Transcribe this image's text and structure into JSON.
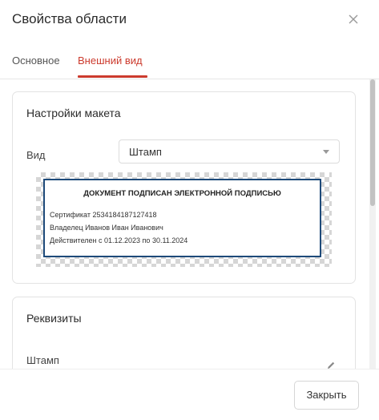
{
  "dialog": {
    "title": "Свойства области"
  },
  "tabs": [
    {
      "label": "Основное",
      "active": false
    },
    {
      "label": "Внешний вид",
      "active": true
    }
  ],
  "layout_card": {
    "title": "Настройки макета",
    "view_label": "Вид",
    "view_value": "Штамп"
  },
  "stamp": {
    "header": "ДОКУМЕНТ ПОДПИСАН ЭЛЕКТРОННОЙ ПОДПИСЬЮ",
    "certificate": "Сертификат 2534184187127418",
    "owner": "Владелец Иванов Иван Иванович",
    "validity": "Действителен с 01.12.2023 по 30.11.2024",
    "border_color": "#1e4a7a"
  },
  "requisites_card": {
    "title": "Реквизиты",
    "stamp_label": "Штамп"
  },
  "footer": {
    "close_label": "Закрыть"
  },
  "colors": {
    "accent": "#cc3b2e"
  }
}
